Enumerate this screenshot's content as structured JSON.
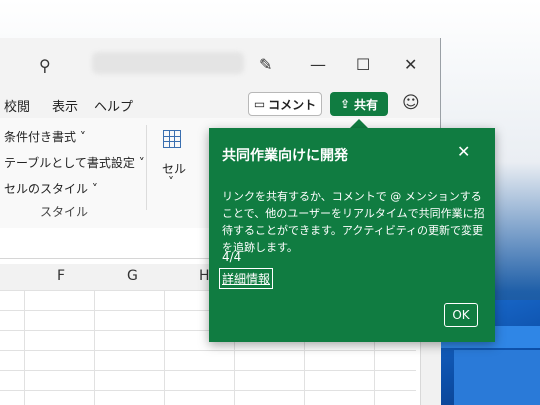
{
  "menu": {
    "items": [
      "校閲",
      "表示",
      "ヘルプ"
    ],
    "comment_label": "コメント",
    "share_label": "共有"
  },
  "ribbon": {
    "conditional_format": "条件付き書式",
    "format_as_table": "テーブルとして書式設定",
    "cell_styles": "セルのスタイル",
    "group_style": "スタイル",
    "cells": "セル"
  },
  "columns": [
    "F",
    "G",
    "H"
  ],
  "popup": {
    "title": "共同作業向けに開発",
    "body": "リンクを共有するか、コメントで @ メンションすることで、他のユーザーをリアルタイムで共同作業に招待することができます。アクティビティの更新で変更を追跡します。",
    "step": "4/4",
    "link": "詳細情報",
    "ok": "OK"
  },
  "colors": {
    "accent": "#107c41"
  }
}
